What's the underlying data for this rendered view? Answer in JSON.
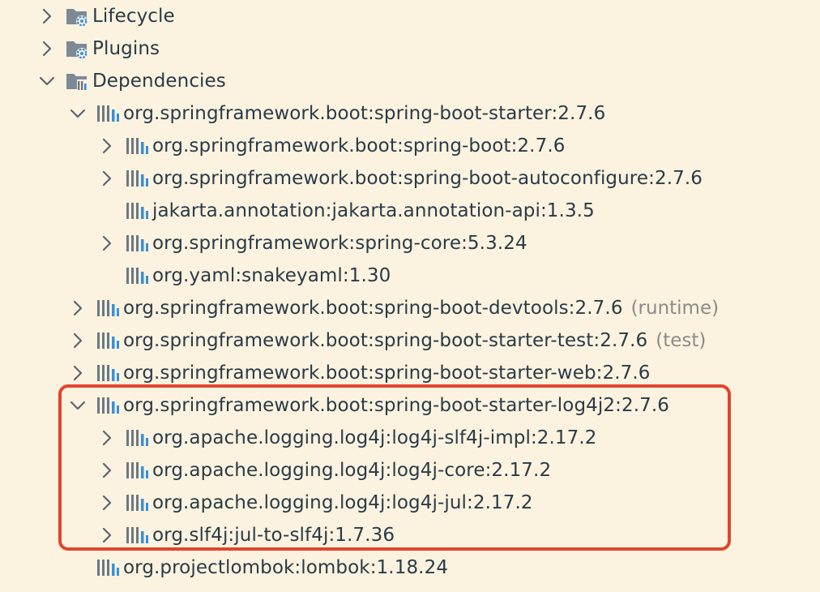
{
  "colors": {
    "background": "#fbf3df",
    "text": "#2a3a48",
    "scope": "#8a8a8a",
    "highlight": "#e2442e",
    "folder": "#7d8a96",
    "gear": "#3a8fd9"
  },
  "tree": {
    "lifecycle": {
      "label": "Lifecycle",
      "icon": "folder-gear-icon",
      "expanded": false
    },
    "plugins": {
      "label": "Plugins",
      "icon": "folder-gear-icon",
      "expanded": false
    },
    "dependencies": {
      "label": "Dependencies",
      "icon": "folder-library-icon",
      "expanded": true,
      "items": [
        {
          "label": "org.springframework.boot:spring-boot-starter:2.7.6",
          "expanded": true,
          "children": [
            {
              "label": "org.springframework.boot:spring-boot:2.7.6"
            },
            {
              "label": "org.springframework.boot:spring-boot-autoconfigure:2.7.6"
            },
            {
              "label": "jakarta.annotation:jakarta.annotation-api:1.3.5"
            },
            {
              "label": "org.springframework:spring-core:5.3.24"
            },
            {
              "label": "org.yaml:snakeyaml:1.30"
            }
          ]
        },
        {
          "label": "org.springframework.boot:spring-boot-devtools:2.7.6",
          "scope": "(runtime)"
        },
        {
          "label": "org.springframework.boot:spring-boot-starter-test:2.7.6",
          "scope": "(test)"
        },
        {
          "label": "org.springframework.boot:spring-boot-starter-web:2.7.6"
        },
        {
          "label": "org.springframework.boot:spring-boot-starter-log4j2:2.7.6",
          "expanded": true,
          "children": [
            {
              "label": "org.apache.logging.log4j:log4j-slf4j-impl:2.17.2"
            },
            {
              "label": "org.apache.logging.log4j:log4j-core:2.17.2"
            },
            {
              "label": "org.apache.logging.log4j:log4j-jul:2.17.2"
            },
            {
              "label": "org.slf4j:jul-to-slf4j:1.7.36"
            }
          ]
        },
        {
          "label": "org.projectlombok:lombok:1.18.24"
        }
      ]
    }
  }
}
